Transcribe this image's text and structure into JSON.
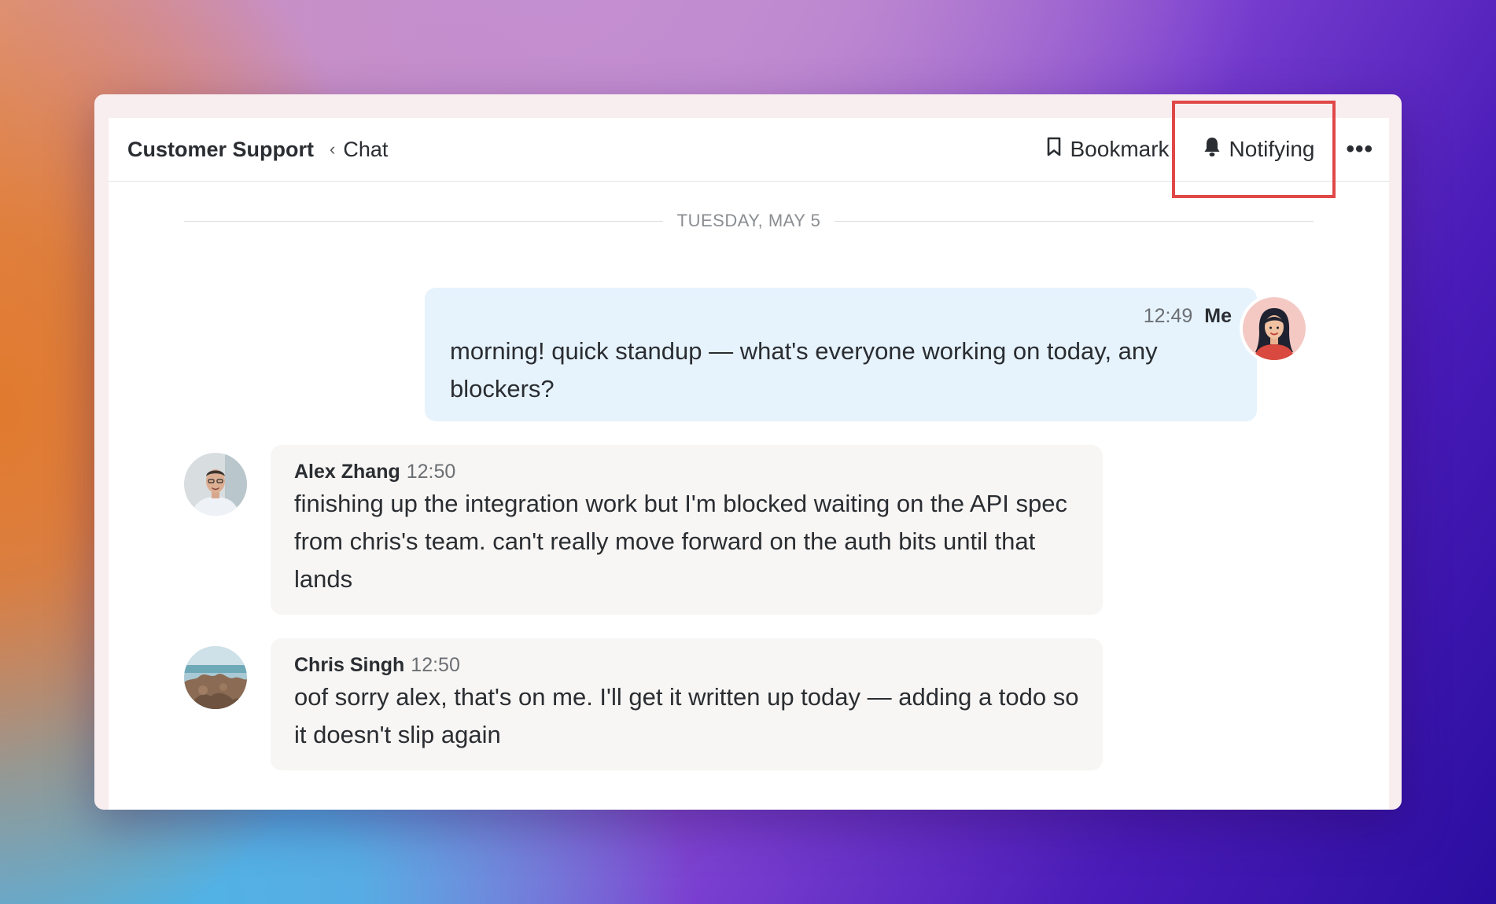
{
  "header": {
    "workspace": "Customer Support",
    "breadcrumb": "Chat",
    "bookmark_label": "Bookmark",
    "notify_label": "Notifying",
    "more_label": "•••"
  },
  "conversation": {
    "date_divider": "TUESDAY, MAY 5",
    "messages": [
      {
        "author": "Me",
        "time": "12:49",
        "text": "morning! quick standup — what's everyone working on today, any blockers?"
      },
      {
        "author": "Alex Zhang",
        "time": "12:50",
        "text": "finishing up the integration work but I'm blocked waiting on the API spec from chris's team. can't really move forward on the auth bits until that lands"
      },
      {
        "author": "Chris Singh",
        "time": "12:50",
        "text": "oof sorry alex, that's on me. I'll get it written up today — adding a todo so it doesn't slip again"
      }
    ]
  },
  "colors": {
    "highlight": "#e04848",
    "my_bubble": "#e6f3fd",
    "other_bubble": "#f7f6f4"
  }
}
